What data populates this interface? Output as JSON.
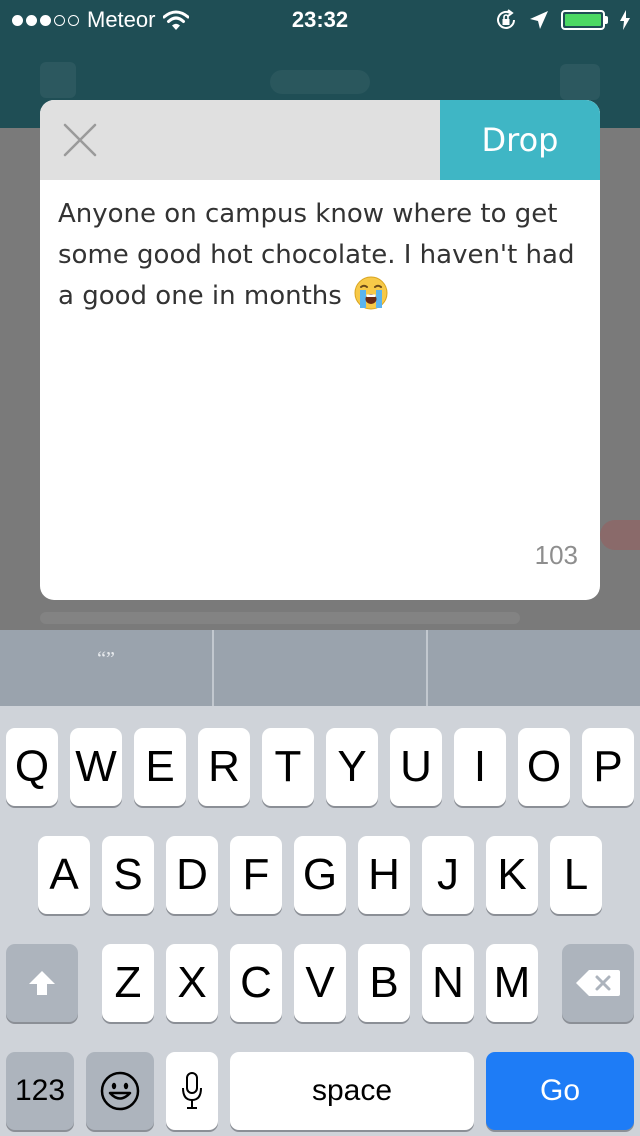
{
  "status_bar": {
    "carrier": "Meteor",
    "time": "23:32",
    "signal_dots": [
      true,
      true,
      true,
      false,
      false
    ],
    "battery_level": 1.0,
    "icons": [
      "wifi-icon",
      "rotation-lock-icon",
      "location-arrow-icon",
      "battery-icon",
      "charging-bolt-icon"
    ]
  },
  "compose": {
    "drop_label": "Drop",
    "text": "Anyone on campus know where to get some good hot chocolate. I haven't had a good one in months",
    "emoji": "loudly-crying-face-icon",
    "char_count": "103"
  },
  "suggestions": [
    "“”",
    "",
    ""
  ],
  "keyboard": {
    "row1": [
      "Q",
      "W",
      "E",
      "R",
      "T",
      "Y",
      "U",
      "I",
      "O",
      "P"
    ],
    "row2": [
      "A",
      "S",
      "D",
      "F",
      "G",
      "H",
      "J",
      "K",
      "L"
    ],
    "row3": [
      "Z",
      "X",
      "C",
      "V",
      "B",
      "N",
      "M"
    ],
    "numbers_label": "123",
    "space_label": "space",
    "go_label": "Go"
  },
  "colors": {
    "accent": "#3fb6c5",
    "navbar": "#1f4e55",
    "go_button": "#1e7cf6",
    "battery": "#4cd964"
  }
}
